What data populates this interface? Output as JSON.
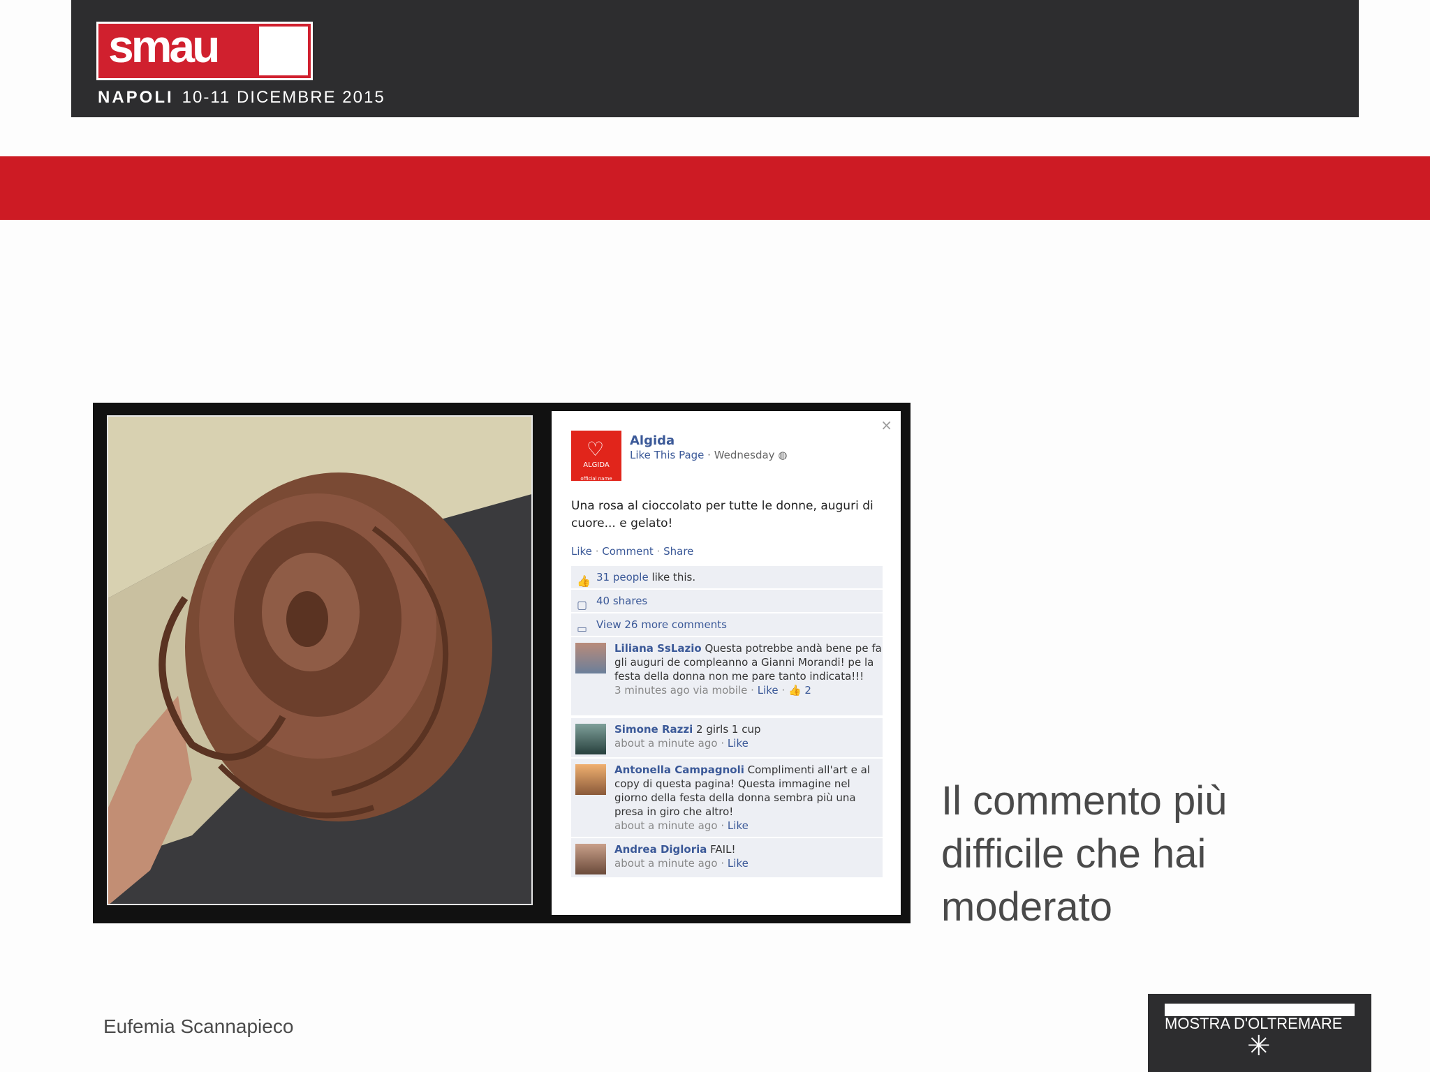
{
  "header": {
    "logo_text": "smau",
    "city": "NAPOLI",
    "dates": "10-11 DICEMBRE 2015"
  },
  "facebook": {
    "close": "×",
    "page_name": "Algida",
    "avatar_label": "ALGIDA",
    "avatar_sublabel": "official name",
    "meta_like": "Like This Page",
    "meta_day": " · Wednesday",
    "post_text": "Una rosa al cioccolato per tutte le donne, auguri di cuore... e gelato!",
    "actions": [
      "Like",
      "Comment",
      "Share"
    ],
    "likes_count": "31 people",
    "likes_text": " like this.",
    "shares": "40 shares",
    "view_more": "View 26 more comments",
    "comments": [
      {
        "name": "Liliana SsLazio",
        "text": " Questa potrebbe andà bene pe fa gli auguri de compleanno a Gianni Morandi! pe la festa della donna non me pare tanto indicata!!!",
        "time": "3 minutes ago via mobile",
        "like": "Like",
        "like_count": "2"
      },
      {
        "name": "Simone Razzi",
        "text": " 2 girls 1 cup",
        "time": "about a minute ago",
        "like": "Like"
      },
      {
        "name": "Antonella Campagnoli",
        "text": " Complimenti all'art e al copy di questa pagina! Questa immagine nel giorno della festa della donna sembra più una presa in giro che altro!",
        "time": "about a minute ago",
        "like": "Like"
      },
      {
        "name": "Andrea Digloria",
        "text": " FAIL!",
        "time": "about a minute ago",
        "like": "Like"
      }
    ]
  },
  "caption": "Il commento più difficile che hai moderato",
  "author": "Eufemia Scannapieco",
  "footer_logo": "MOSTRA D'OLTREMARE",
  "colors": {
    "brand_red": "#cd1b24",
    "dark": "#2d2d2f",
    "fb_blue": "#3b5998"
  }
}
